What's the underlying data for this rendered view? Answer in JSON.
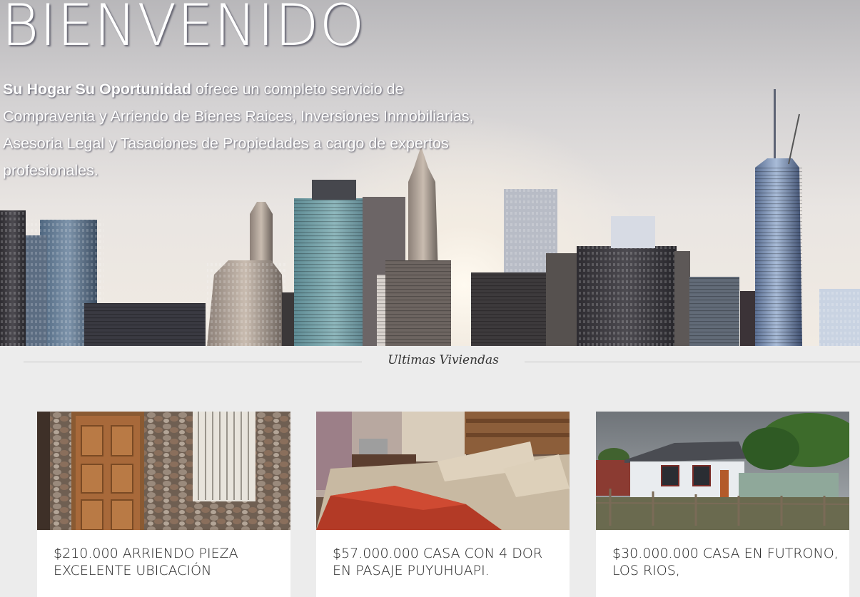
{
  "hero": {
    "title": "BIENVENIDO",
    "brand": "Su Hogar Su Oportunidad",
    "description": " ofrece un completo servicio de Compraventa y Arriendo de Bienes Raices, Inversiones Inmobiliarias, Asesoria Legal y Tasaciones de Propiedades a cargo de expertos profesionales."
  },
  "section": {
    "title": "Ultimas Viviendas"
  },
  "listings": [
    {
      "title": "$210.000 ARRIENDO PIEZA EXCELENTE UBICACIÓN"
    },
    {
      "title": "$57.000.000 CASA CON 4 DOR EN PASAJE PUYUHUAPI."
    },
    {
      "title": "$30.000.000 CASA EN FUTRONO, LOS RIOS,"
    }
  ]
}
